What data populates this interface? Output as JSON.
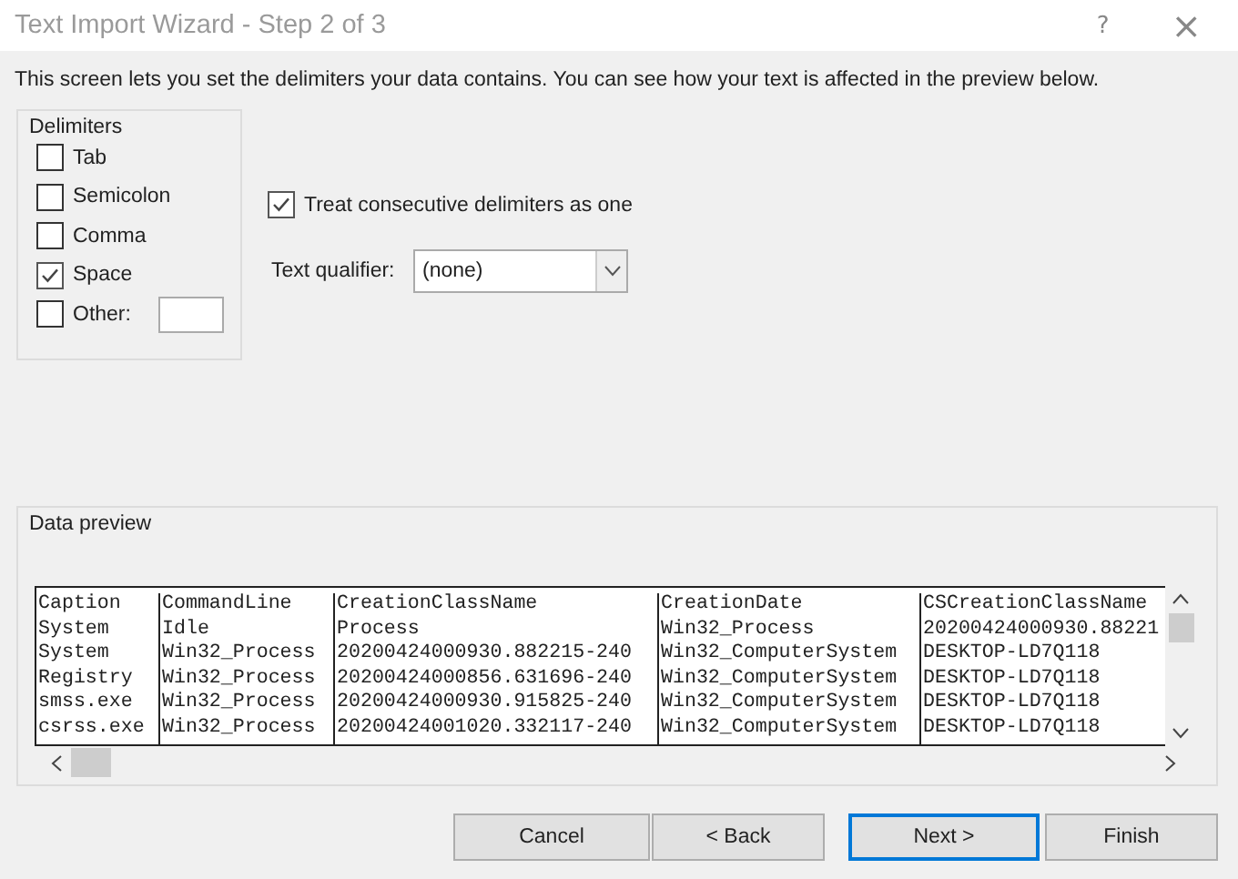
{
  "window": {
    "title": "Text Import Wizard - Step 2 of 3",
    "help": "?",
    "close": "×"
  },
  "description": "This screen lets you set the delimiters your data contains.  You can see how your text is affected in the preview below.",
  "delimiters": {
    "label": "Delimiters",
    "options": [
      {
        "label": "Tab",
        "checked": false
      },
      {
        "label": "Semicolon",
        "checked": false
      },
      {
        "label": "Comma",
        "checked": false
      },
      {
        "label": "Space",
        "checked": true
      },
      {
        "label": "Other:",
        "checked": false,
        "kind": "with-field"
      }
    ]
  },
  "consecutive": {
    "label": "Treat consecutive delimiters as one",
    "checked": true
  },
  "qualifier": {
    "label": "Text qualifier:",
    "value": "(none)"
  },
  "preview": {
    "label": "Data preview",
    "rows": [
      [
        "Caption",
        "CommandLine",
        "CreationClassName",
        "CreationDate",
        "CSCreationClassName"
      ],
      [
        "System",
        "Idle",
        "Process",
        "Win32_Process",
        "20200424000930.88221"
      ],
      [
        "System",
        "Win32_Process",
        "20200424000930.882215-240",
        "Win32_ComputerSystem",
        "DESKTOP-LD7Q118"
      ],
      [
        "Registry",
        "Win32_Process",
        "20200424000856.631696-240",
        "Win32_ComputerSystem",
        "DESKTOP-LD7Q118"
      ],
      [
        "smss.exe",
        "Win32_Process",
        "20200424000930.915825-240",
        "Win32_ComputerSystem",
        "DESKTOP-LD7Q118"
      ],
      [
        "csrss.exe",
        "Win32_Process",
        "20200424001020.332117-240",
        "Win32_ComputerSystem",
        "DESKTOP-LD7Q118"
      ]
    ]
  },
  "buttons": [
    {
      "label": "Cancel",
      "selected": false
    },
    {
      "label": "< Back",
      "selected": false
    },
    {
      "label": "Next >",
      "selected": true
    },
    {
      "label": "Finish",
      "selected": false
    }
  ]
}
